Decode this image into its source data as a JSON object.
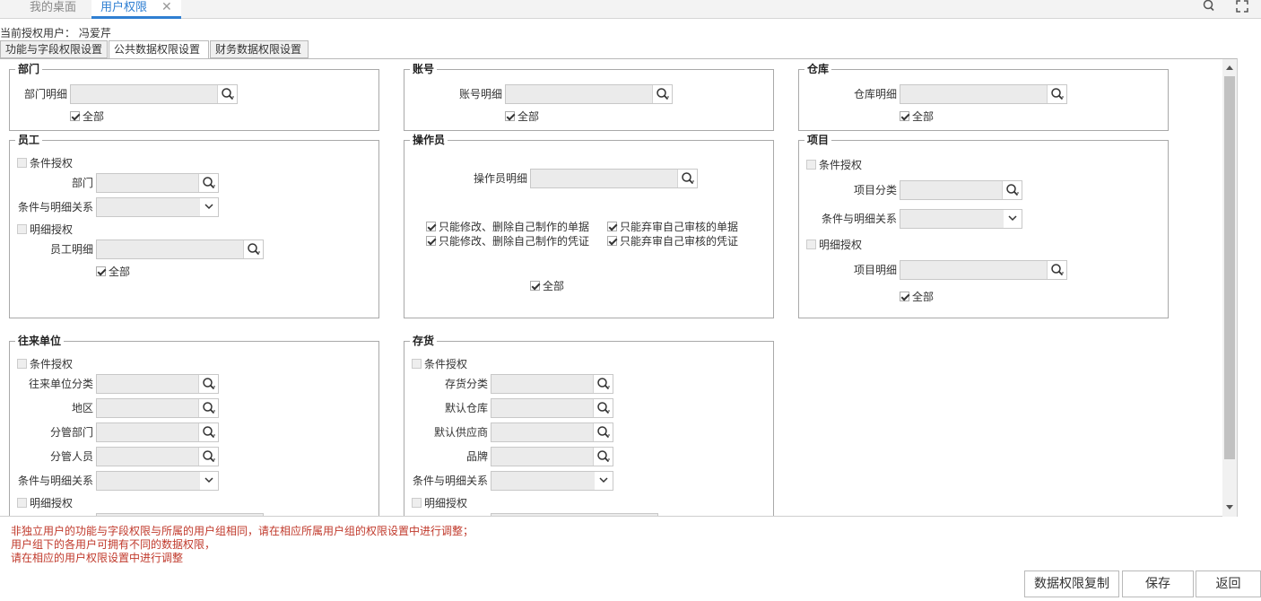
{
  "tabs": {
    "desktop": "我的桌面",
    "user_permission": "用户权限",
    "close": "✕"
  },
  "auth_user": "当前授权用户： 冯爱芹",
  "subtabs": [
    "功能与字段权限设置",
    "公共数据权限设置",
    "财务数据权限设置"
  ],
  "common": {
    "all": "全部",
    "cond_auth": "条件授权",
    "detail_auth": "明细授权",
    "relation": "条件与明细关系"
  },
  "dept": {
    "title": "部门",
    "detail": "部门明细"
  },
  "account": {
    "title": "账号",
    "detail": "账号明细"
  },
  "warehouse": {
    "title": "仓库",
    "detail": "仓库明细"
  },
  "employee": {
    "title": "员工",
    "dept": "部门",
    "detail": "员工明细"
  },
  "operator": {
    "title": "操作员",
    "detail": "操作员明细",
    "opt1": "只能修改、删除自己制作的单据",
    "opt2": "只能弃审自己审核的单据",
    "opt3": "只能修改、删除自己制作的凭证",
    "opt4": "只能弃审自己审核的凭证"
  },
  "project": {
    "title": "项目",
    "category": "项目分类",
    "detail": "项目明细"
  },
  "partner": {
    "title": "往来单位",
    "category": "往来单位分类",
    "region": "地区",
    "dept": "分管部门",
    "person": "分管人员"
  },
  "inventory": {
    "title": "存货",
    "category": "存货分类",
    "warehouse": "默认仓库",
    "supplier": "默认供应商",
    "brand": "品牌"
  },
  "notes": [
    "非独立用户的功能与字段权限与所属的用户组相同，请在相应所属用户组的权限设置中进行调整；",
    "用户组下的各用户可拥有不同的数据权限，",
    "请在相应的用户权限设置中进行调整"
  ],
  "buttons": {
    "copy": "数据权限复制",
    "save": "保存",
    "back": "返回"
  },
  "colors": {
    "accent": "#2f7fd2",
    "note": "#c0392b"
  }
}
